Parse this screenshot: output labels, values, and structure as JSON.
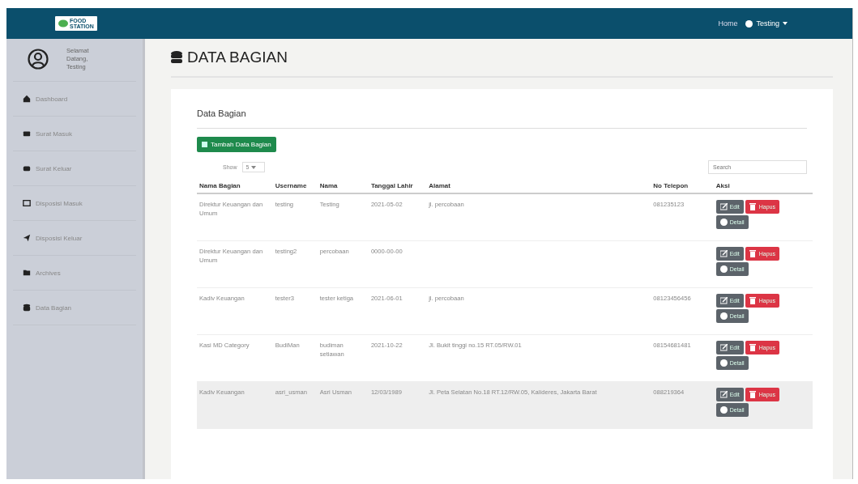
{
  "navbar": {
    "logo_text": "FOOD STATION",
    "links": [
      "Home"
    ],
    "user_menu": "Testing"
  },
  "sidebar": {
    "greeting": "Selamat Datang, Testing",
    "items": [
      {
        "label": "Dashboard",
        "selected": false
      },
      {
        "label": "Surat Masuk",
        "selected": false
      },
      {
        "label": "Surat Keluar",
        "selected": false
      },
      {
        "label": "Disposisi Masuk",
        "selected": false
      },
      {
        "label": "Disposisi Keluar",
        "selected": false
      },
      {
        "label": "Archives",
        "selected": false
      },
      {
        "label": "Data Bagian",
        "selected": false
      }
    ]
  },
  "page_title": "DATA BAGIAN",
  "card": {
    "title": "Data Bagian",
    "add_button": "Tambah Data Bagian",
    "show_label": "Show",
    "show_value": "5",
    "search": {
      "placeholder": "Search"
    },
    "table": {
      "columns": [
        "Nama Bagian",
        "Username",
        "Nama",
        "Tanggal Lahir",
        "Alamat",
        "No Telepon",
        "Aksi"
      ],
      "rows": [
        {
          "cells": [
            "Direktur Keuangan dan Umum",
            "testing",
            "Testing",
            "2021-05-02",
            "jl. percobaan",
            "081235123"
          ],
          "actions": [
            "Edit",
            "Hapus",
            "Detail"
          ],
          "hovered": false
        },
        {
          "cells": [
            "Direktur Keuangan dan Umum",
            "testing2",
            "percobaan",
            "0000-00-00",
            "",
            ""
          ],
          "actions": [
            "Edit",
            "Hapus",
            "Detail"
          ],
          "hovered": false
        },
        {
          "cells": [
            "Kadiv Keuangan",
            "tester3",
            "tester ketiga",
            "2021-06-01",
            "jl. percobaan",
            "08123456456"
          ],
          "actions": [
            "Edit",
            "Hapus",
            "Detail"
          ],
          "hovered": false
        },
        {
          "cells": [
            "Kasi MD Category",
            "BudiMan",
            "budiman setiawan",
            "2021-10-22",
            "Jl. Bukit tinggi no.15 RT.05/RW.01",
            "08154681481"
          ],
          "actions": [
            "Edit",
            "Hapus",
            "Detail"
          ],
          "hovered": false
        },
        {
          "cells": [
            "Kadiv Keuangan",
            "asri_usman",
            "Asri Usman",
            "12/03/1989",
            "Jl. Peta Selatan No.18 RT.12/RW.05, Kalideres, Jakarta Barat",
            "088219364"
          ],
          "actions": [
            "Edit",
            "Hapus",
            "Detail"
          ],
          "hovered": true
        }
      ]
    }
  }
}
